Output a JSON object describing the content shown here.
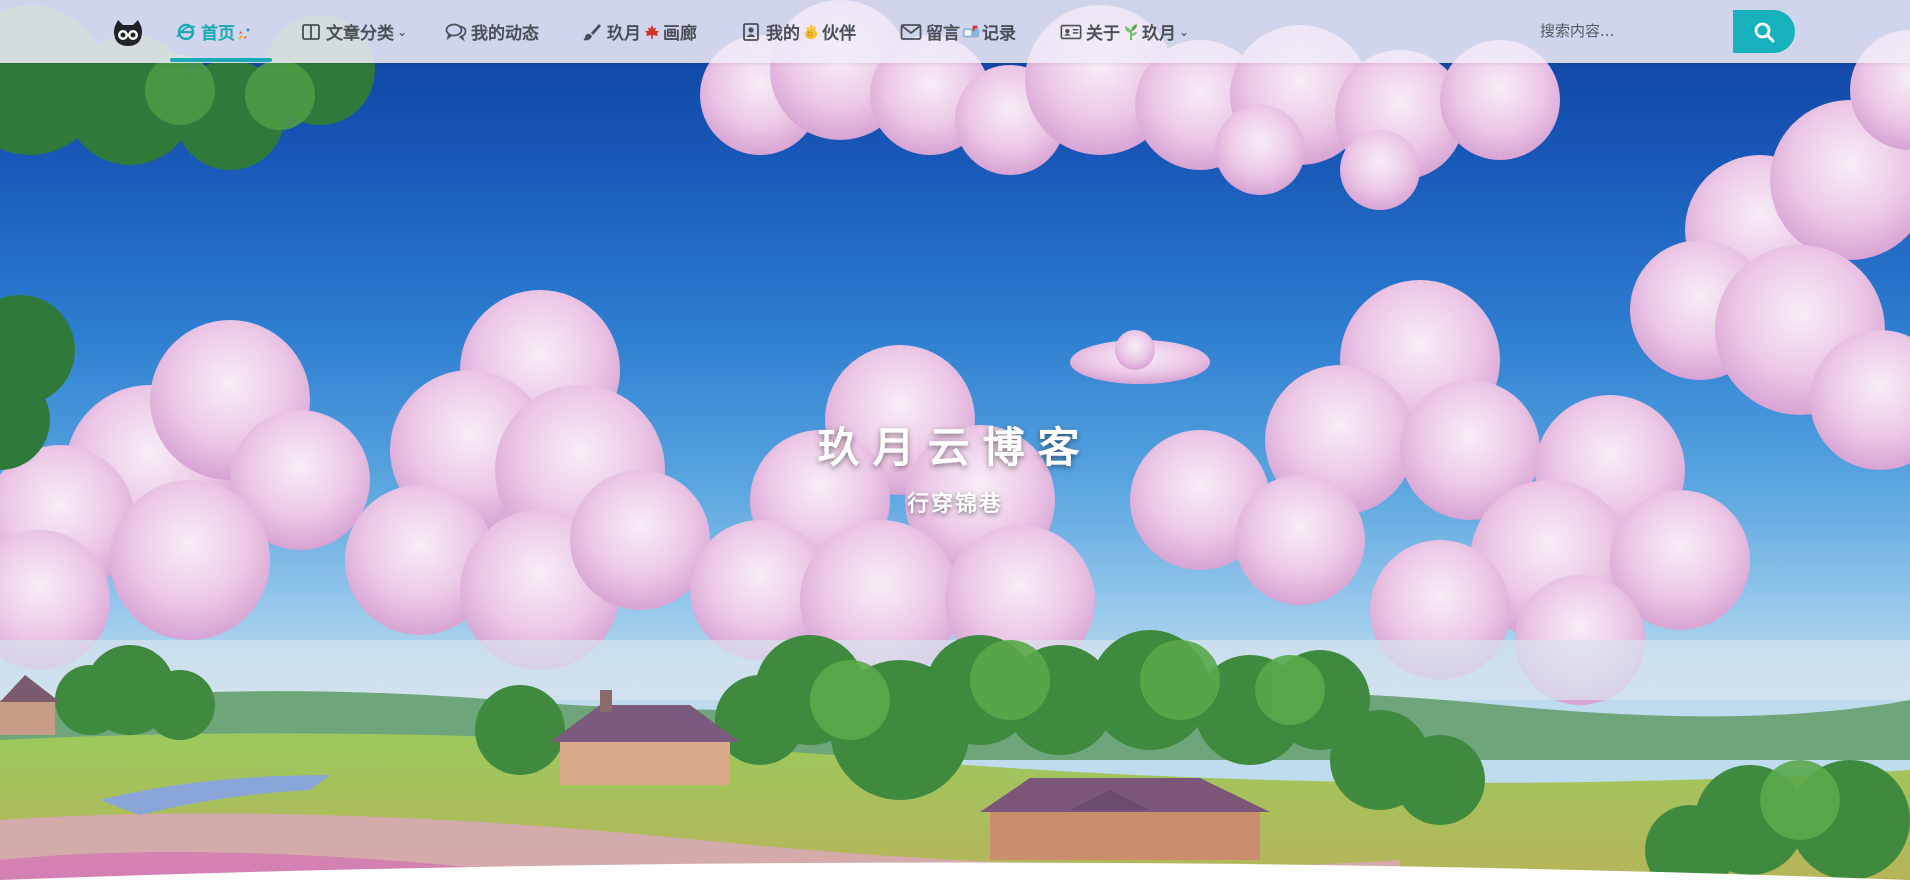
{
  "nav": {
    "items": [
      {
        "label": "首页",
        "icon": "ie-logo-icon",
        "emoji": "rocket-emoji",
        "active": true
      },
      {
        "label": "文章分类",
        "icon": "columns-icon",
        "dropdown": true
      },
      {
        "label": "我的动态",
        "icon": "chat-bubbles-icon"
      },
      {
        "label_a": "玖月",
        "label_b": "画廊",
        "icon": "paintbrush-icon",
        "emoji": "maple-leaf-emoji"
      },
      {
        "label_a": "我的",
        "label_b": "伙伴",
        "icon": "contact-icon",
        "emoji": "ok-hand-emoji"
      },
      {
        "label_a": "留言",
        "label_b": "记录",
        "icon": "envelope-icon",
        "emoji": "mailbox-emoji"
      },
      {
        "label_a": "关于",
        "label_b": "玖月",
        "icon": "id-card-icon",
        "emoji": "herb-emoji",
        "dropdown": true
      }
    ]
  },
  "search": {
    "placeholder": "搜索内容..."
  },
  "hero": {
    "title": "玖月云博客",
    "subtitle": "行穿锦巷"
  },
  "colors": {
    "accent": "#1aa9b5",
    "search_button": "#16b1bc",
    "nav_text": "#4a4f58"
  }
}
